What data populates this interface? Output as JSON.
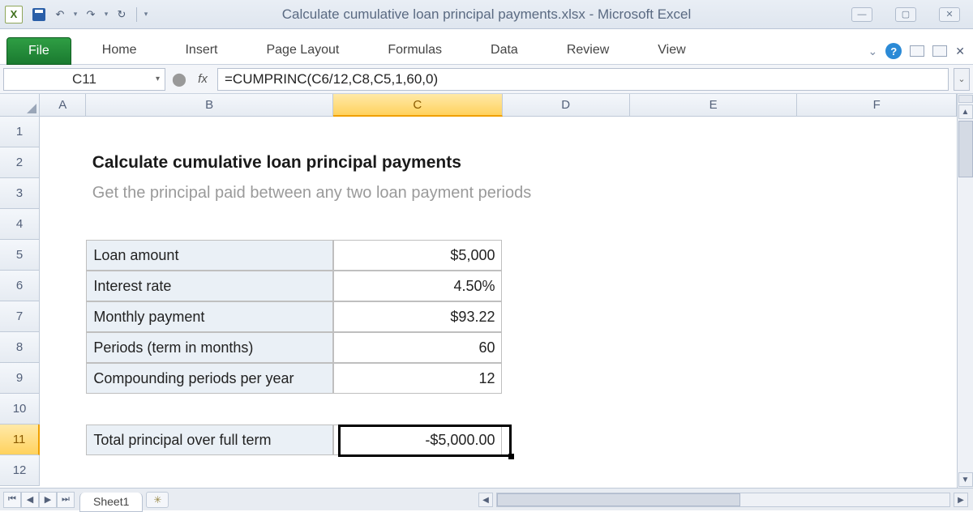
{
  "titlebar": {
    "title": "Calculate cumulative loan principal payments.xlsx - Microsoft Excel"
  },
  "qat": {
    "excel": "X",
    "undo": "↶",
    "redo": "↷",
    "refresh": "↻"
  },
  "ribbon": {
    "file": "File",
    "tabs": [
      "Home",
      "Insert",
      "Page Layout",
      "Formulas",
      "Data",
      "Review",
      "View"
    ]
  },
  "formula_bar": {
    "name_box": "C11",
    "fx": "fx",
    "formula": "=CUMPRINC(C6/12,C8,C5,1,60,0)"
  },
  "columns": [
    "A",
    "B",
    "C",
    "D",
    "E",
    "F"
  ],
  "selected_column": "C",
  "row_count": 12,
  "selected_row": 11,
  "content": {
    "title": "Calculate cumulative loan principal payments",
    "subtitle": "Get the principal paid between any two loan payment periods",
    "rows": [
      {
        "label": "Loan amount",
        "value": "$5,000"
      },
      {
        "label": "Interest rate",
        "value": "4.50%"
      },
      {
        "label": "Monthly payment",
        "value": "$93.22"
      },
      {
        "label": "Periods (term in months)",
        "value": "60"
      },
      {
        "label": "Compounding periods per year",
        "value": "12"
      }
    ],
    "result": {
      "label": "Total principal over full term",
      "value": "-$5,000.00"
    }
  },
  "sheet_tabs": {
    "active": "Sheet1"
  }
}
